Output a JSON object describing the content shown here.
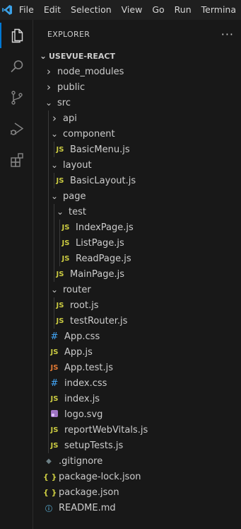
{
  "menu": [
    "File",
    "Edit",
    "Selection",
    "View",
    "Go",
    "Run",
    "Termina"
  ],
  "explorer": {
    "title": "EXPLORER",
    "more": "···",
    "root": "USEVUE-REACT"
  },
  "tree": [
    {
      "label": "node_modules",
      "depth": 0,
      "kind": "folder",
      "open": false
    },
    {
      "label": "public",
      "depth": 0,
      "kind": "folder",
      "open": false
    },
    {
      "label": "src",
      "depth": 0,
      "kind": "folder",
      "open": true
    },
    {
      "label": "api",
      "depth": 1,
      "kind": "folder",
      "open": false
    },
    {
      "label": "component",
      "depth": 1,
      "kind": "folder",
      "open": true
    },
    {
      "label": "BasicMenu.js",
      "depth": 2,
      "kind": "js"
    },
    {
      "label": "layout",
      "depth": 1,
      "kind": "folder",
      "open": true
    },
    {
      "label": "BasicLayout.js",
      "depth": 2,
      "kind": "js"
    },
    {
      "label": "page",
      "depth": 1,
      "kind": "folder",
      "open": true
    },
    {
      "label": "test",
      "depth": 2,
      "kind": "folder",
      "open": true
    },
    {
      "label": "IndexPage.js",
      "depth": 3,
      "kind": "js"
    },
    {
      "label": "ListPage.js",
      "depth": 3,
      "kind": "js"
    },
    {
      "label": "ReadPage.js",
      "depth": 3,
      "kind": "js"
    },
    {
      "label": "MainPage.js",
      "depth": 2,
      "kind": "js"
    },
    {
      "label": "router",
      "depth": 1,
      "kind": "folder",
      "open": true
    },
    {
      "label": "root.js",
      "depth": 2,
      "kind": "js"
    },
    {
      "label": "testRouter.js",
      "depth": 2,
      "kind": "js"
    },
    {
      "label": "App.css",
      "depth": 1,
      "kind": "css"
    },
    {
      "label": "App.js",
      "depth": 1,
      "kind": "js"
    },
    {
      "label": "App.test.js",
      "depth": 1,
      "kind": "jstest"
    },
    {
      "label": "index.css",
      "depth": 1,
      "kind": "css"
    },
    {
      "label": "index.js",
      "depth": 1,
      "kind": "js"
    },
    {
      "label": "logo.svg",
      "depth": 1,
      "kind": "svg"
    },
    {
      "label": "reportWebVitals.js",
      "depth": 1,
      "kind": "js"
    },
    {
      "label": "setupTests.js",
      "depth": 1,
      "kind": "js"
    },
    {
      "label": ".gitignore",
      "depth": 0,
      "kind": "git"
    },
    {
      "label": "package-lock.json",
      "depth": 0,
      "kind": "json"
    },
    {
      "label": "package.json",
      "depth": 0,
      "kind": "json"
    },
    {
      "label": "README.md",
      "depth": 0,
      "kind": "info"
    }
  ],
  "icon_glyphs": {
    "js": "JS",
    "jstest": "JS",
    "css": "#",
    "json": "{ }",
    "git": "◆",
    "info": "ⓘ"
  },
  "colors": {
    "accent": "#0078d4",
    "js": "#cbcb41",
    "css": "#42a5f5",
    "svg": "#a074c4",
    "test": "#e37933"
  }
}
